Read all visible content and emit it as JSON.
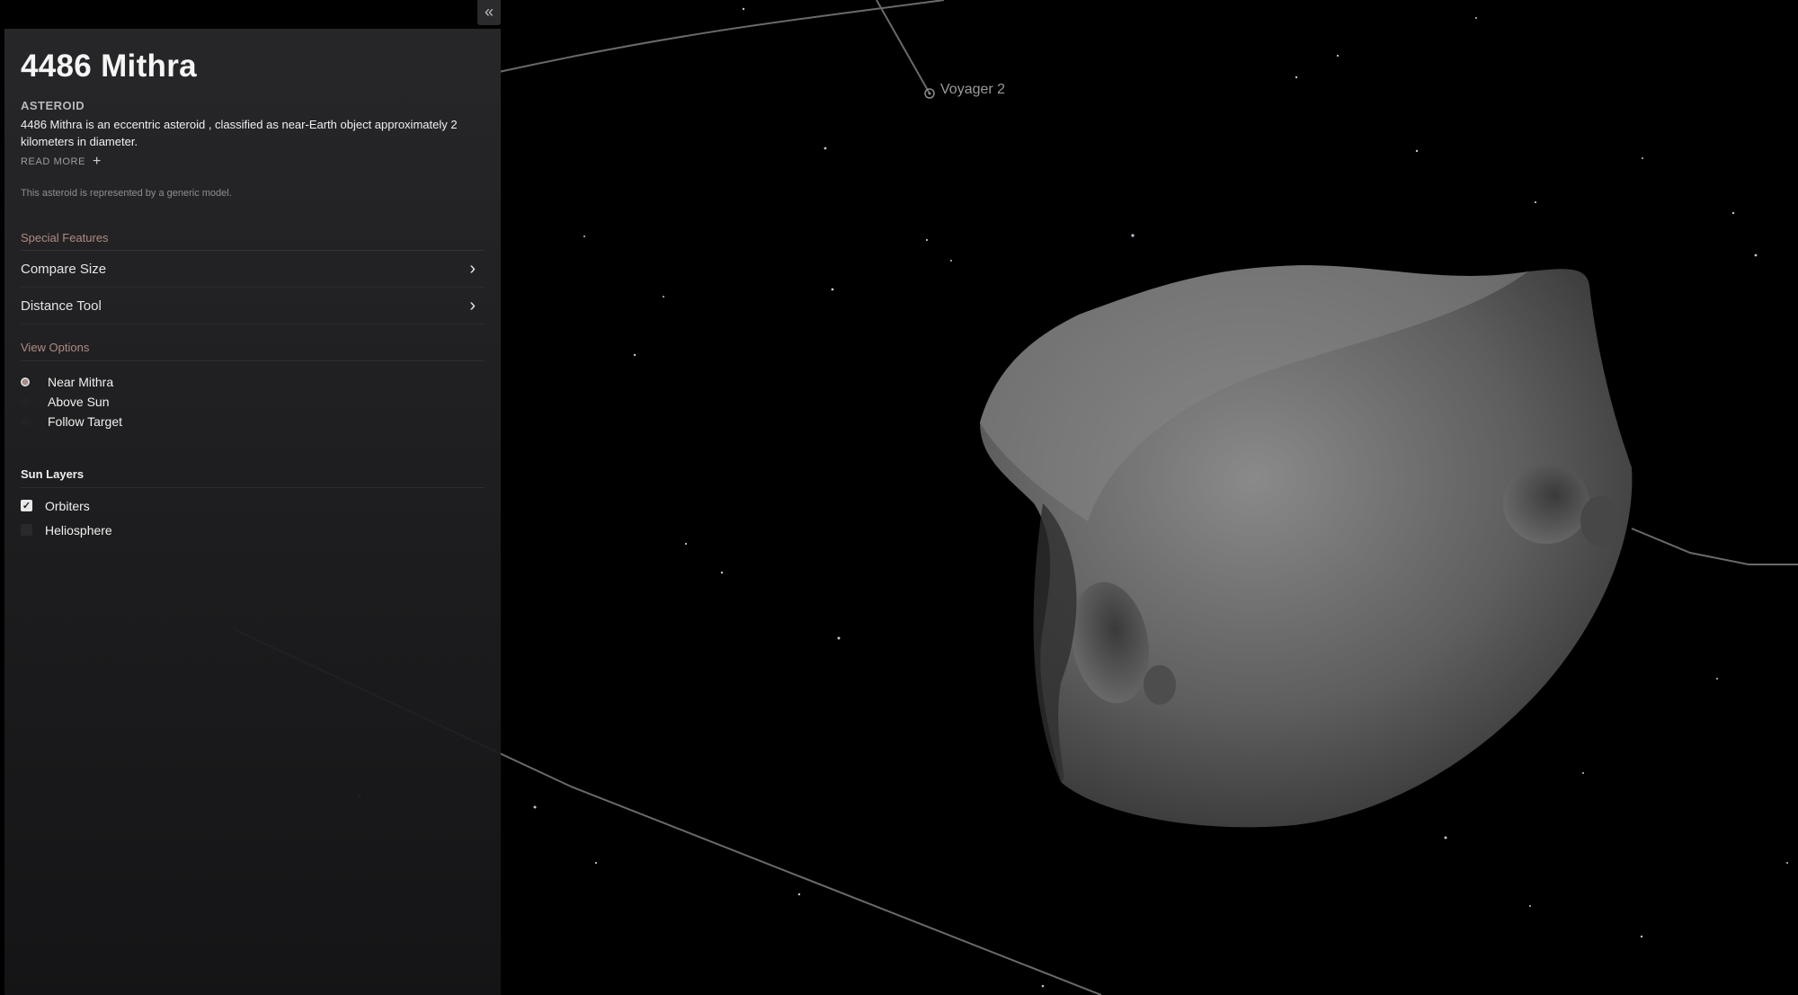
{
  "scene": {
    "spacecraft_label": "Voyager 2"
  },
  "panel": {
    "collapse_icon": "double-chevron-left-icon",
    "title": "4486 Mithra",
    "category": "ASTEROID",
    "description": "4486 Mithra is an eccentric asteroid , classified as near-Earth object approximately 2 kilometers in diameter.",
    "read_more": "READ MORE",
    "model_note": "This asteroid is represented by a generic model."
  },
  "special_features": {
    "heading": "Special Features",
    "items": [
      {
        "label": "Compare Size"
      },
      {
        "label": "Distance Tool"
      }
    ]
  },
  "view_options": {
    "heading": "View Options",
    "options": [
      {
        "label": "Near Mithra",
        "selected": true
      },
      {
        "label": "Above Sun",
        "selected": false
      },
      {
        "label": "Follow Target",
        "selected": false
      }
    ]
  },
  "sun_layers": {
    "heading": "Sun Layers",
    "layers": [
      {
        "label": "Orbiters",
        "checked": true
      },
      {
        "label": "Heliosphere",
        "checked": false
      }
    ]
  },
  "colors": {
    "accent": "#b08a84",
    "panel_bg": "#28282b",
    "background": "#000000"
  }
}
